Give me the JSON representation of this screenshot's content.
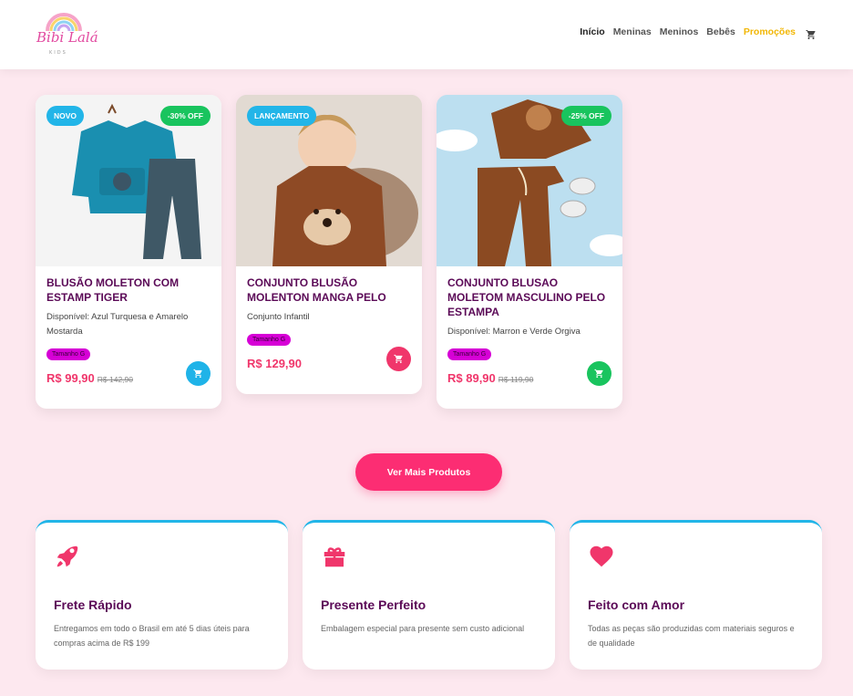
{
  "brand": {
    "name": "Bibi Lalá",
    "sub": "KIDS"
  },
  "nav": {
    "items": [
      "Início",
      "Meninas",
      "Meninos",
      "Bebês",
      "Promoções"
    ]
  },
  "products": [
    {
      "badge_left": "NOVO",
      "badge_right": "-30% OFF",
      "title": "BLUSÃO MOLETON COM ESTAMP TIGER",
      "desc": "Disponível: Azul Turquesa e Amarelo Mostarda",
      "size": "Tamanho G",
      "price": "R$ 99,90",
      "old_price": "R$ 142,90",
      "cart_color": "#1fb3e8"
    },
    {
      "badge_left": "LANÇAMENTO",
      "badge_right": "",
      "title": "CONJUNTO BLUSÃO MOLENTON MANGA PELO",
      "desc": "Conjunto Infantil",
      "size": "Tamanho G",
      "price": "R$ 129,90",
      "old_price": "",
      "cart_color": "#f0366b"
    },
    {
      "badge_left": "",
      "badge_right": "-25% OFF",
      "title": "CONJUNTO BLUSAO MOLETOM MASCULINO PELO ESTAMPA",
      "desc": "Disponível: Marron e Verde Orgiva",
      "size": "Tamanho G",
      "price": "R$ 89,90",
      "old_price": "R$ 119,90",
      "cart_color": "#19c45e"
    }
  ],
  "cta": {
    "label": "Ver Mais Produtos"
  },
  "features": [
    {
      "icon": "rocket-icon",
      "title": "Frete Rápido",
      "text": "Entregamos em todo o Brasil em até 5 dias úteis para compras acima de R$ 199"
    },
    {
      "icon": "gift-icon",
      "title": "Presente Perfeito",
      "text": "Embalagem especial para presente sem custo adicional"
    },
    {
      "icon": "heart-icon",
      "title": "Feito com Amor",
      "text": "Todas as peças são produzidas com materiais seguros e de qualidade"
    }
  ],
  "colors": {
    "background": "#fde8ef",
    "title": "#5b0a57",
    "price": "#f0366b",
    "accent_pink": "#fc2d73",
    "accent_blue": "#22b5e8",
    "accent_green": "#19c45e",
    "promo": "#f2b705"
  }
}
